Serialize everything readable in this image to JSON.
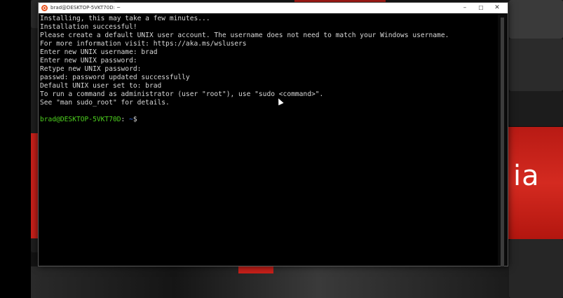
{
  "window": {
    "title": "brad@DESKTOP-5VKT70D: ~",
    "minimize_glyph": "–",
    "maximize_glyph": "☐",
    "close_glyph": "✕",
    "icon": "ubuntu-icon"
  },
  "terminal": {
    "lines": [
      "Installing, this may take a few minutes...",
      "Installation successful!",
      "Please create a default UNIX user account. The username does not need to match your Windows username.",
      "For more information visit: https://aka.ms/wslusers",
      "Enter new UNIX username: brad",
      "Enter new UNIX password:",
      "Retype new UNIX password:",
      "passwd: password updated successfully",
      "Default UNIX user set to: brad",
      "To run a command as administrator (user \"root\"), use \"sudo <command>\".",
      "See \"man sudo_root\" for details."
    ],
    "prompt": {
      "user_host": "brad@DESKTOP-5VKT70D",
      "separator": ":",
      "path": " ~",
      "symbol": "$"
    }
  },
  "wallpaper": {
    "text": "ia"
  },
  "colors": {
    "prompt_user": "#4ed11f",
    "prompt_path": "#3b78ff",
    "accent_red": "#c8201a",
    "terminal_text": "#d8d8d8"
  }
}
